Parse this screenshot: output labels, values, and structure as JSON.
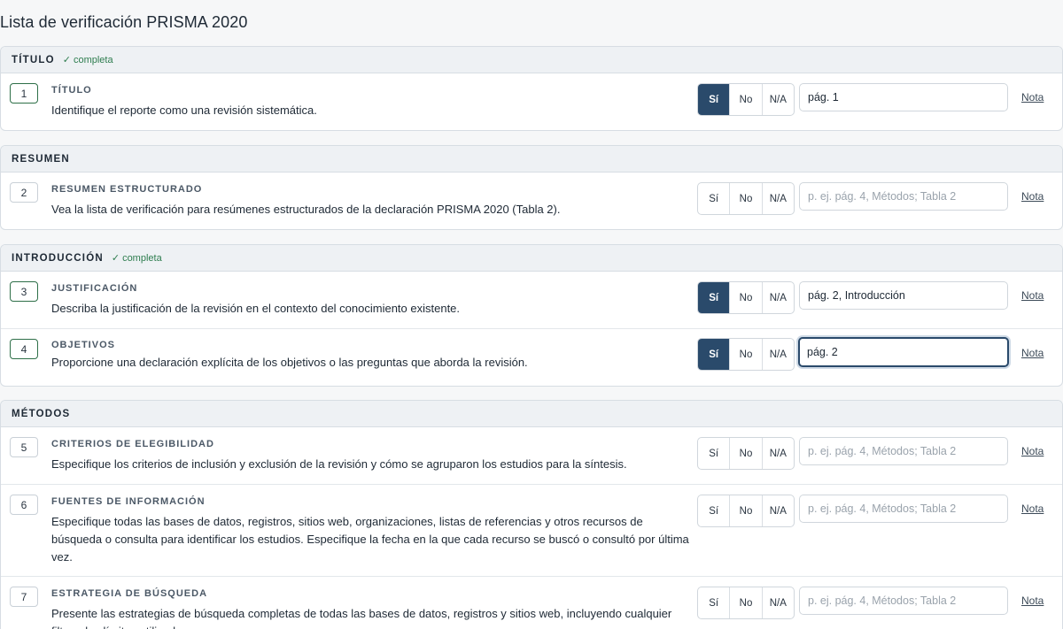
{
  "page_title": "Lista de verificación PRISMA 2020",
  "complete_label": "completa",
  "options": {
    "yes": "Sí",
    "no": "No",
    "na": "N/A"
  },
  "note_label": "Nota",
  "placeholder": "p. ej. pág. 4, Métodos; Tabla 2",
  "sections": [
    {
      "title": "TÍTULO",
      "complete": true,
      "items": [
        {
          "num": "1",
          "label": "TÍTULO",
          "desc": "Identifique el reporte como una revisión sistemática.",
          "answer": "yes",
          "page": "pág. 1"
        }
      ]
    },
    {
      "title": "RESUMEN",
      "complete": false,
      "items": [
        {
          "num": "2",
          "label": "RESUMEN ESTRUCTURADO",
          "desc": "Vea la lista de verificación para resúmenes estructurados de la declaración PRISMA 2020 (Tabla 2).",
          "answer": "",
          "page": ""
        }
      ]
    },
    {
      "title": "INTRODUCCIÓN",
      "complete": true,
      "items": [
        {
          "num": "3",
          "label": "JUSTIFICACIÓN",
          "desc": "Describa la justificación de la revisión en el contexto del conocimiento existente.",
          "answer": "yes",
          "page": "pág. 2, Introducción"
        },
        {
          "num": "4",
          "label": "OBJETIVOS",
          "desc": "Proporcione una declaración explícita de los objetivos o las preguntas que aborda la revisión.",
          "answer": "yes",
          "page": "pág. 2"
        }
      ]
    },
    {
      "title": "MÉTODOS",
      "complete": false,
      "items": [
        {
          "num": "5",
          "label": "CRITERIOS DE ELEGIBILIDAD",
          "desc": "Especifique los criterios de inclusión y exclusión de la revisión y cómo se agruparon los estudios para la síntesis.",
          "answer": "",
          "page": ""
        },
        {
          "num": "6",
          "label": "FUENTES DE INFORMACIÓN",
          "desc": "Especifique todas las bases de datos, registros, sitios web, organizaciones, listas de referencias y otros recursos de búsqueda o consulta para identificar los estudios. Especifique la fecha en la que cada recurso se buscó o consultó por última vez.",
          "answer": "",
          "page": ""
        },
        {
          "num": "7",
          "label": "ESTRATEGIA DE BÚSQUEDA",
          "desc": "Presente las estrategias de búsqueda completas de todas las bases de datos, registros y sitios web, incluyendo cualquier filtro y los límites utilizados.",
          "answer": "",
          "page": ""
        }
      ]
    }
  ]
}
